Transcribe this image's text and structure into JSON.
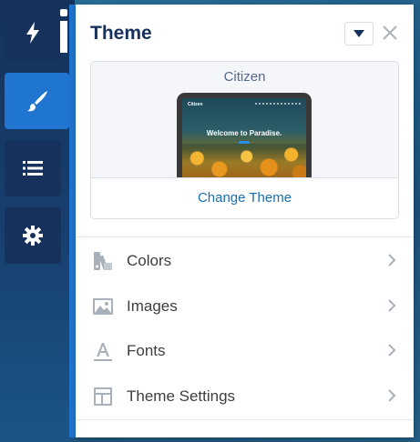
{
  "rail": {
    "buttons": [
      {
        "name": "lightning",
        "active": false
      },
      {
        "name": "theme",
        "active": true
      },
      {
        "name": "page-structure",
        "active": false
      },
      {
        "name": "settings",
        "active": false
      }
    ],
    "active_color": "#1f75cf",
    "button_color": "#16325c"
  },
  "panel": {
    "title": "Theme",
    "theme_card": {
      "theme_name": "Citizen",
      "preview_brand": "Citizen",
      "preview_heading": "Welcome to Paradise.",
      "change_label": "Change Theme"
    },
    "menu": [
      {
        "label": "Colors",
        "icon": "palette-icon"
      },
      {
        "label": "Images",
        "icon": "image-icon"
      },
      {
        "label": "Fonts",
        "icon": "font-icon"
      },
      {
        "label": "Theme Settings",
        "icon": "layout-icon"
      }
    ]
  },
  "colors": {
    "title": "#16325c",
    "link": "#1a6fb3",
    "icon_gray": "#a8b0ba"
  }
}
